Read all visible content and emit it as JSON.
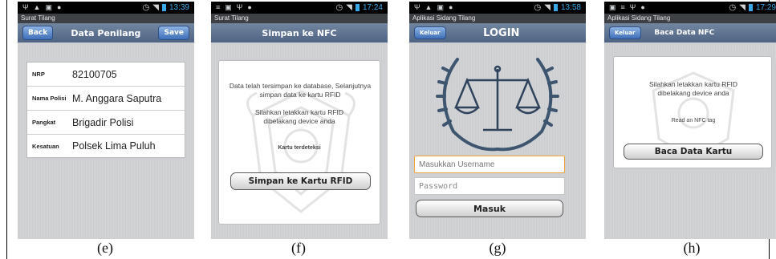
{
  "status": {
    "e": {
      "time": "13:39"
    },
    "f": {
      "time": "17:24"
    },
    "g": {
      "time": "13:58"
    },
    "h": {
      "time": "17:29"
    }
  },
  "screen_e": {
    "app_title": "Surat Tilang",
    "back_label": "Back",
    "header": "Data Penilang",
    "save_label": "Save",
    "rows": [
      {
        "label": "NRP",
        "value": "82100705"
      },
      {
        "label": "Nama Polisi",
        "value": "M. Anggara Saputra"
      },
      {
        "label": "Pangkat",
        "value": "Brigadir Polisi"
      },
      {
        "label": "Kesatuan",
        "value": "Polsek Lima Puluh"
      }
    ]
  },
  "screen_f": {
    "app_title": "Surat Tilang",
    "header": "Simpan ke NFC",
    "msg1": "Data telah tersimpan ke database, Selanjutnya simpan data ke kartu RFID",
    "msg2": "Silahkan letakkan kartu RFID dibelakang device anda",
    "detected": "Kartu terdeteksi",
    "button": "Simpan ke Kartu RFID"
  },
  "screen_g": {
    "app_title": "Aplikasi Sidang Tilang",
    "exit_label": "Keluar",
    "header": "LOGIN",
    "username_placeholder": "Masukkan Username",
    "password_placeholder": "Password",
    "button": "Masuk"
  },
  "screen_h": {
    "app_title": "Aplikasi Sidang Tilang",
    "exit_label": "Keluar",
    "header": "Baca Data NFC",
    "msg": "Silahkan letakkan kartu RFID dibelakang device anda",
    "nfc_status": "Read an NFC tag",
    "button": "Baca Data Kartu"
  },
  "captions": [
    "(e)",
    "(f)",
    "(g)",
    "(h)"
  ],
  "colors": {
    "accent_time": "#3aa8e8",
    "actionbar": "#4f6483",
    "field_focus": "#f0a43c"
  }
}
